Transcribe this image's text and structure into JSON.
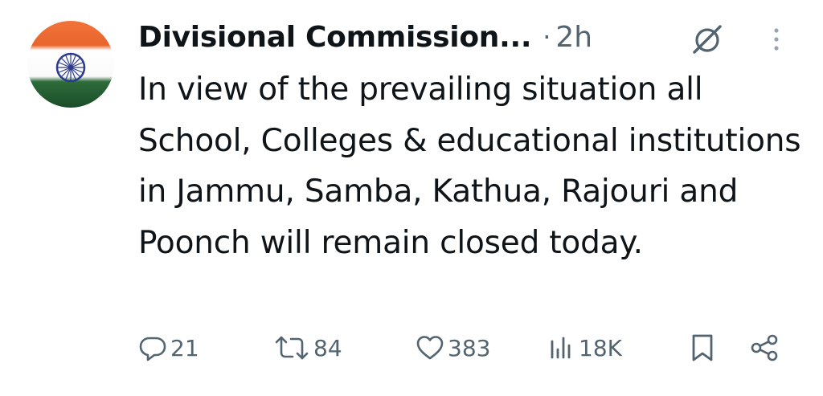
{
  "post": {
    "author_name": "Divisional Commission...",
    "separator": "·",
    "time": "2h",
    "text": "In view of the prevailing situation all School, Colleges & educational institutions in Jammu, Samba, Kathua, Rajouri and Poonch will remain closed today."
  },
  "actions": {
    "replies": "21",
    "reposts": "84",
    "likes": "383",
    "views": "18K"
  },
  "icons": {
    "reply": "speech-bubble-icon",
    "repost": "repost-arrows-icon",
    "like": "heart-icon",
    "views": "bar-chart-icon",
    "bookmark": "bookmark-icon",
    "share": "share-nodes-icon",
    "grok": "grok-slash-circle-icon",
    "more": "vertical-ellipsis-icon"
  },
  "colors": {
    "text": "#0f1419",
    "muted": "#536471",
    "flag_saffron": "#e8652d",
    "flag_green": "#1b4d28",
    "chakra_blue": "#2b3a8c"
  }
}
